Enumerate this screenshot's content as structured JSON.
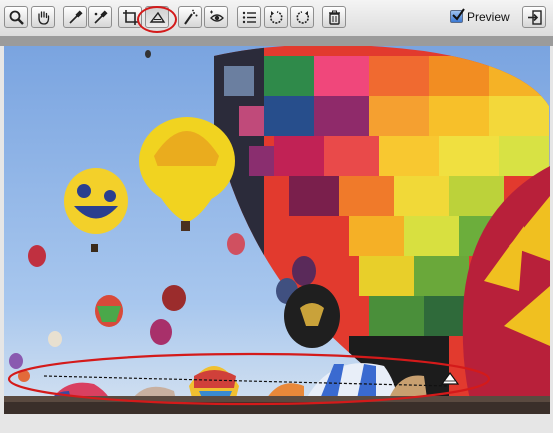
{
  "toolbar": {
    "tools": [
      {
        "id": "zoom",
        "icon": "zoom-icon"
      },
      {
        "id": "hand",
        "icon": "hand-icon"
      },
      {
        "id": "white-balance",
        "icon": "eyedropper-icon"
      },
      {
        "id": "color-sampler",
        "icon": "color-sampler-icon"
      },
      {
        "id": "crop",
        "icon": "crop-icon"
      },
      {
        "id": "straighten",
        "icon": "straighten-icon",
        "selected": true
      },
      {
        "id": "spot-removal",
        "icon": "spot-removal-icon"
      },
      {
        "id": "red-eye",
        "icon": "red-eye-icon"
      },
      {
        "id": "preferences",
        "icon": "list-icon"
      },
      {
        "id": "rotate-left",
        "icon": "rotate-left-icon"
      },
      {
        "id": "rotate-right",
        "icon": "rotate-right-icon"
      },
      {
        "id": "trash",
        "icon": "trash-icon"
      }
    ],
    "preview": {
      "label": "Preview",
      "checked": true
    },
    "fullscreen_icon": "fullscreen-icon"
  },
  "annotation_color": "#d41a1a",
  "image": {
    "description_icon": "hot-air-balloons-photo"
  }
}
